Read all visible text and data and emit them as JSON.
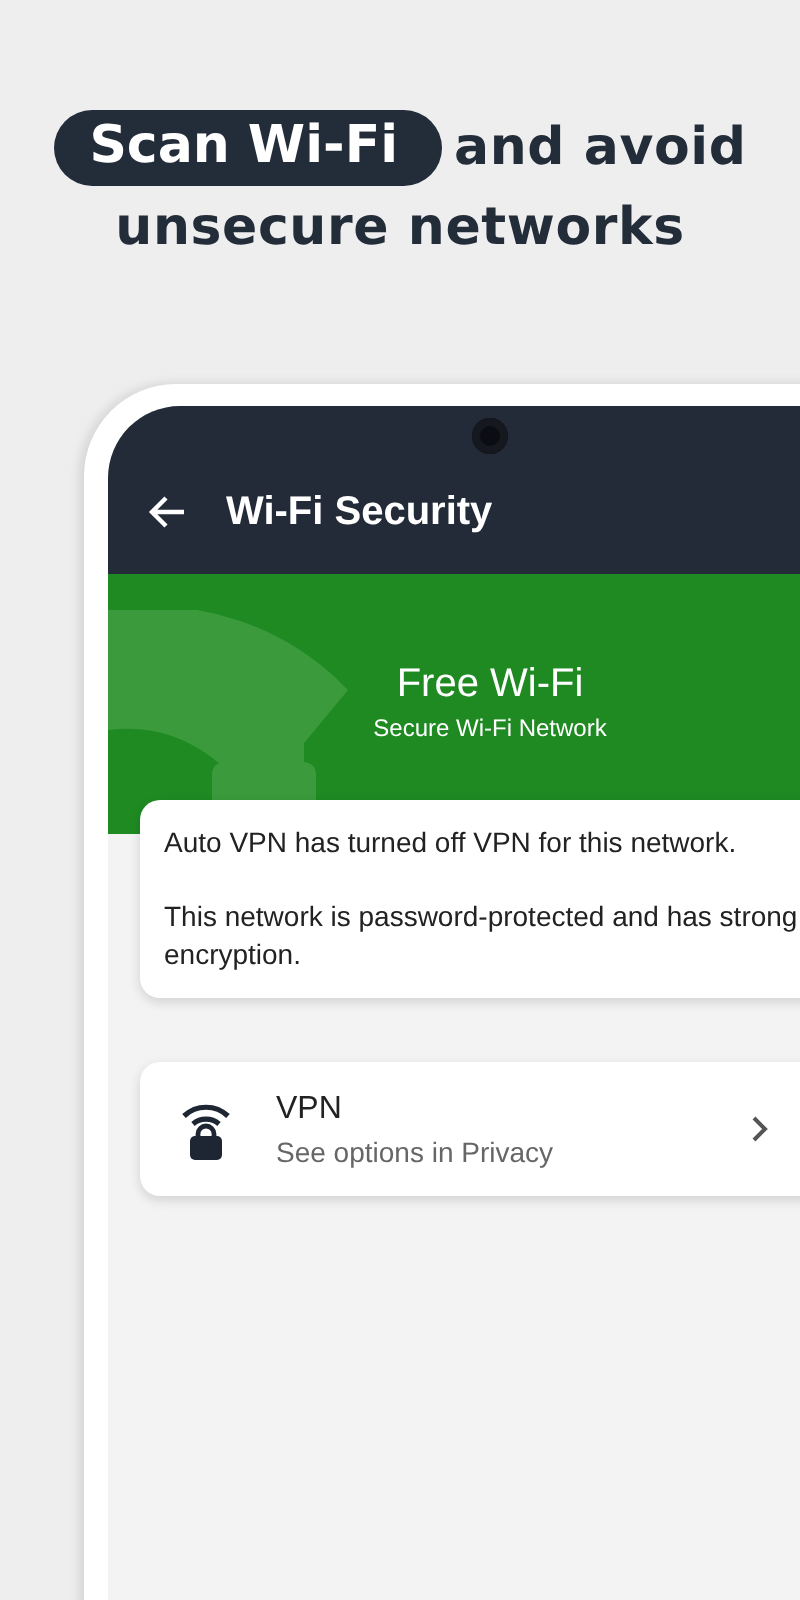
{
  "headline": {
    "highlight": "Scan Wi-Fi",
    "rest": "and avoid",
    "line2": "unsecure networks"
  },
  "app_bar": {
    "title": "Wi-Fi Security"
  },
  "network": {
    "name": "Free Wi-Fi",
    "subtitle": "Secure Wi-Fi Network"
  },
  "status_card": {
    "messages": [
      "Auto VPN has turned off VPN for this network.",
      "This network is password-protected and has strong encryption."
    ]
  },
  "options": [
    {
      "title": "VPN",
      "subtitle": "See options in Privacy"
    }
  ]
}
